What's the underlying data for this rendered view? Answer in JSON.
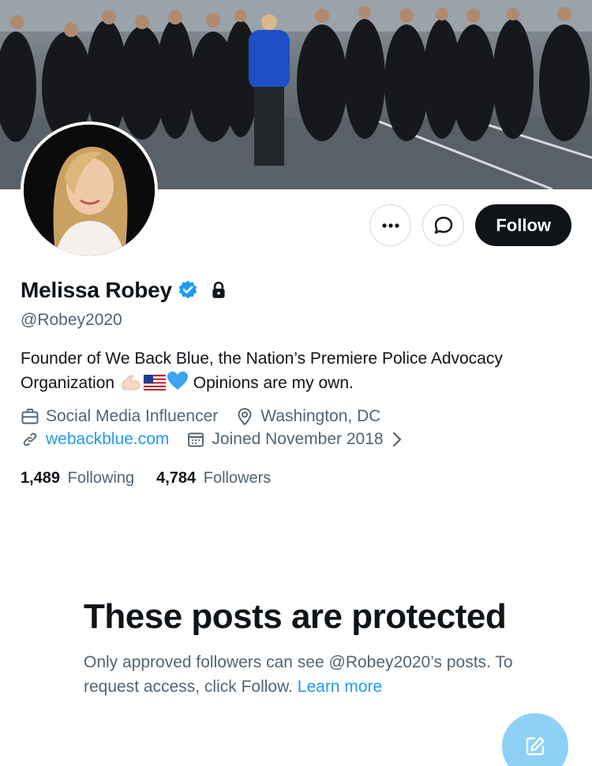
{
  "profile": {
    "display_name": "Melissa Robey",
    "handle": "@Robey2020",
    "verified": true,
    "protected": true,
    "bio_text_1": "Founder of We Back Blue, the Nation’s Premiere Police Advocacy Organization",
    "bio_text_2": "Opinions are my own.",
    "bio_emojis": [
      "flexed-biceps-emoji",
      "us-flag-emoji",
      "blue-heart-emoji"
    ],
    "category": "Social Media Influencer",
    "location": "Washington, DC",
    "website": "webackblue.com",
    "joined": "Joined November 2018",
    "following_count": "1,489",
    "following_label": "Following",
    "followers_count": "4,784",
    "followers_label": "Followers"
  },
  "actions": {
    "follow_label": "Follow",
    "more_icon": "more-horizontal-icon",
    "message_icon": "message-bubble-icon"
  },
  "protected_notice": {
    "title": "These posts are protected",
    "body": "Only approved followers can see @Robey2020’s posts. To request access, click Follow.",
    "learn_more": "Learn more"
  },
  "colors": {
    "accent": "#1d9bf0",
    "text_primary": "#0f1419",
    "text_secondary": "#536471",
    "follow_button": "#0f1419",
    "fab": "#8fd0f7"
  }
}
